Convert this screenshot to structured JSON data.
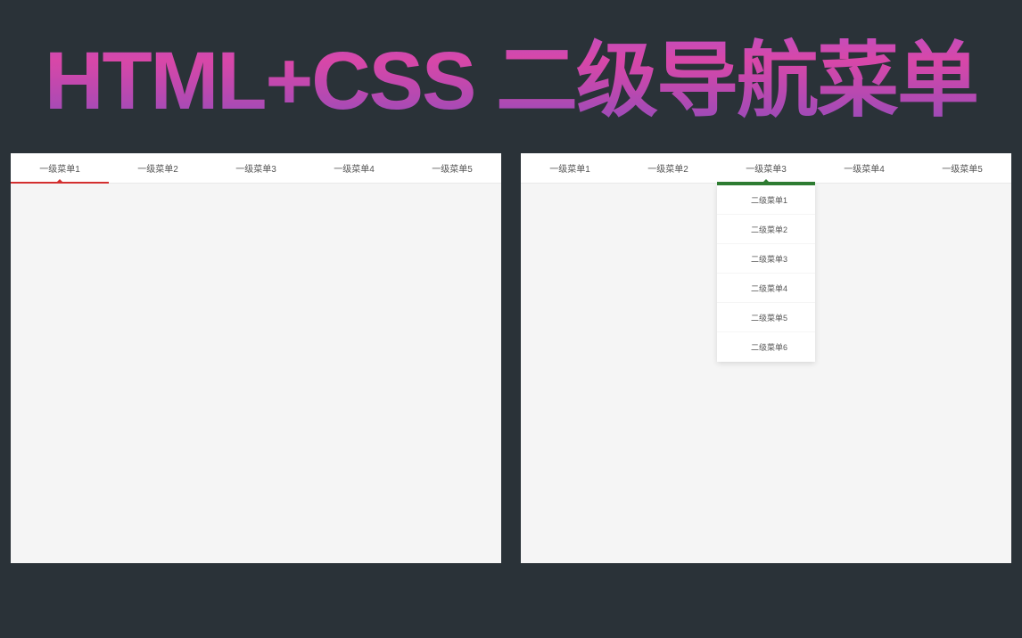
{
  "title": "HTML+CSS 二级导航菜单",
  "leftPanel": {
    "navItems": [
      {
        "label": "一级菜单1",
        "active": true
      },
      {
        "label": "一级菜单2",
        "active": false
      },
      {
        "label": "一级菜单3",
        "active": false
      },
      {
        "label": "一级菜单4",
        "active": false
      },
      {
        "label": "一级菜单5",
        "active": false
      }
    ],
    "accentColor": "#d32f2f"
  },
  "rightPanel": {
    "navItems": [
      {
        "label": "一级菜单1",
        "active": false
      },
      {
        "label": "一级菜单2",
        "active": false
      },
      {
        "label": "一级菜单3",
        "active": true
      },
      {
        "label": "一级菜单4",
        "active": false
      },
      {
        "label": "一级菜单5",
        "active": false
      }
    ],
    "dropdownItems": [
      {
        "label": "二级菜单1"
      },
      {
        "label": "二级菜单2"
      },
      {
        "label": "二级菜单3"
      },
      {
        "label": "二级菜单4"
      },
      {
        "label": "二级菜单5"
      },
      {
        "label": "二级菜单6"
      }
    ],
    "accentColor": "#2e7d32"
  }
}
